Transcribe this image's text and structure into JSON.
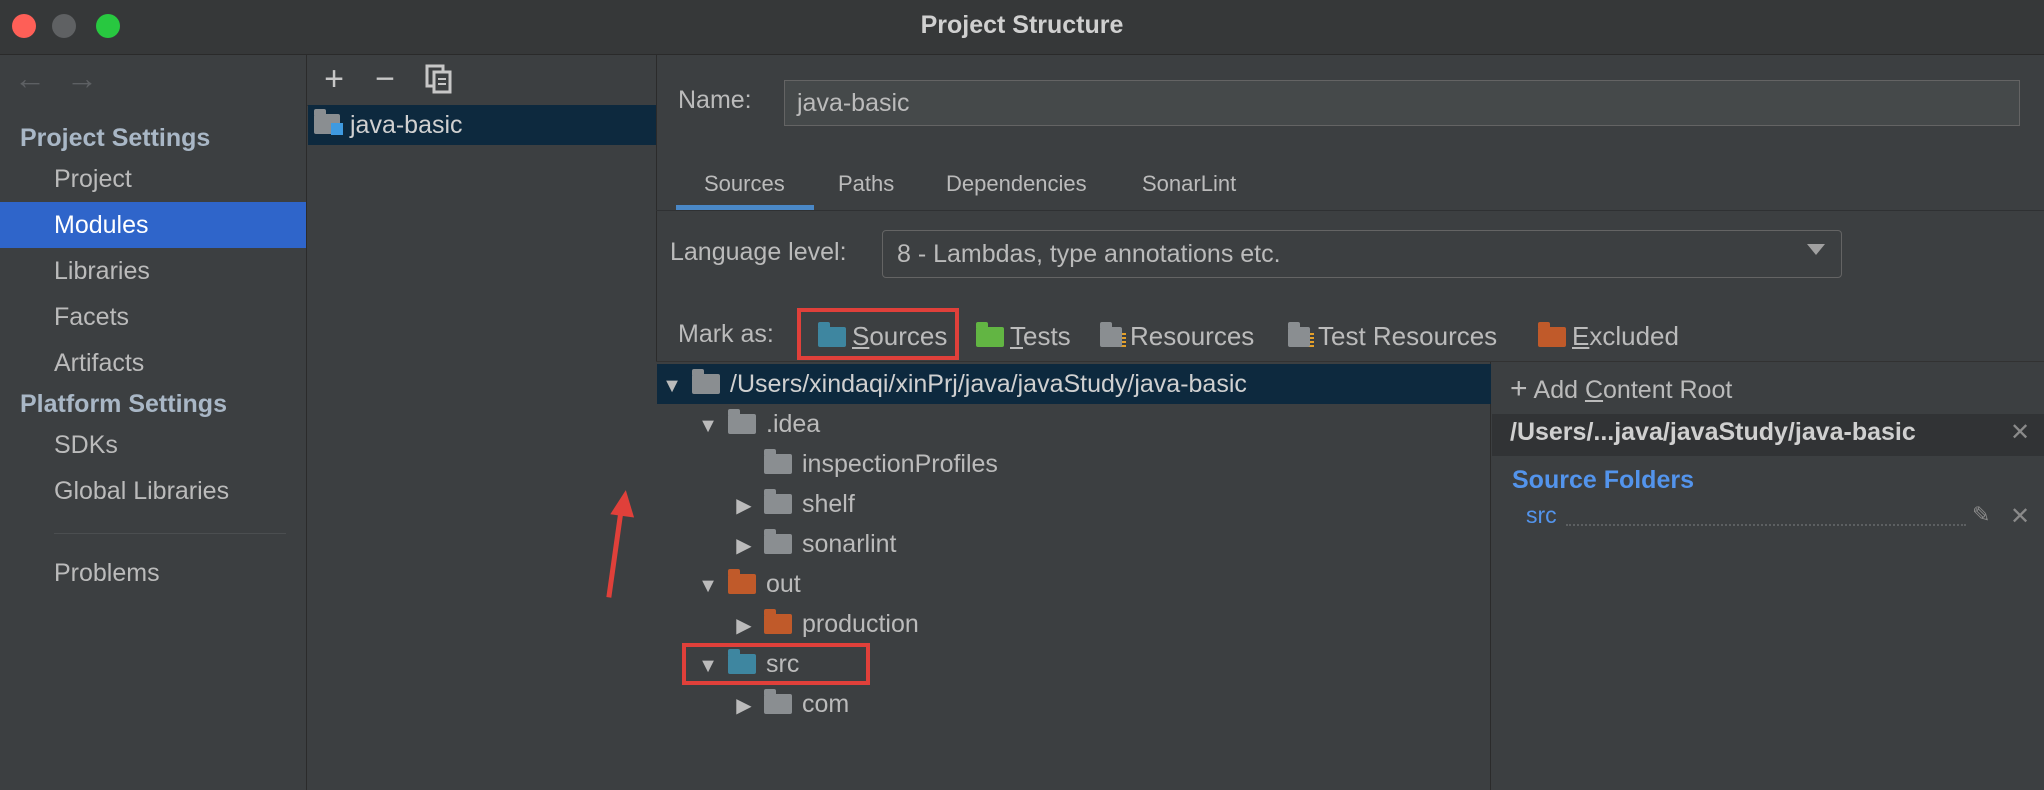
{
  "window": {
    "title": "Project Structure"
  },
  "sidebar": {
    "back_icon": "arrow-left-icon",
    "forward_icon": "arrow-right-icon",
    "project_settings_heading": "Project Settings",
    "project_items": [
      {
        "label": "Project",
        "selected": false
      },
      {
        "label": "Modules",
        "selected": true
      },
      {
        "label": "Libraries",
        "selected": false
      },
      {
        "label": "Facets",
        "selected": false
      },
      {
        "label": "Artifacts",
        "selected": false
      }
    ],
    "platform_settings_heading": "Platform Settings",
    "platform_items": [
      {
        "label": "SDKs"
      },
      {
        "label": "Global Libraries"
      }
    ],
    "problems_label": "Problems"
  },
  "modules": {
    "toolbar": {
      "add": "+",
      "remove": "−",
      "copy_icon": "copy-icon"
    },
    "items": [
      {
        "label": "java-basic",
        "selected": true
      }
    ]
  },
  "module_settings": {
    "name_label": "Name:",
    "name_value": "java-basic",
    "tabs": [
      {
        "label": "Sources",
        "active": true
      },
      {
        "label": "Paths"
      },
      {
        "label": "Dependencies"
      },
      {
        "label": "SonarLint"
      }
    ],
    "language_level_label": "Language level:",
    "language_level_value": "8 - Lambdas, type annotations etc.",
    "mark_as_label": "Mark as:",
    "mark_as": {
      "sources": {
        "first": "S",
        "rest": "ources"
      },
      "tests": {
        "first": "T",
        "rest": "ests"
      },
      "resources": "Resources",
      "test_resources": "Test Resources",
      "excluded": {
        "first": "E",
        "rest": "xcluded"
      }
    }
  },
  "tree": {
    "root": "/Users/xindaqi/xinPrj/java/javaStudy/java-basic",
    "idea": ".idea",
    "inspection": "inspectionProfiles",
    "shelf": "shelf",
    "sonarlint": "sonarlint",
    "out": "out",
    "production": "production",
    "src": "src",
    "com": "com"
  },
  "content_root": {
    "add_label_prefix": "Add ",
    "add_label_underlined": "C",
    "add_label_suffix": "ontent Root",
    "path": "/Users/...java/javaStudy/java-basic",
    "source_folders_heading": "Source Folders",
    "source_folder": "src"
  },
  "colors": {
    "accent_selected": "#2f65ca",
    "tree_selected": "#0d293e",
    "folder_sources": "#3e86a0",
    "folder_tests": "#62b543",
    "folder_excluded": "#c05a2a",
    "link_blue": "#5394ec",
    "annotation_red": "#e0403a"
  }
}
